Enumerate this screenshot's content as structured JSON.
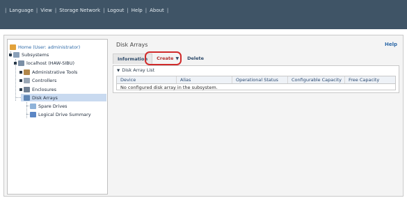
{
  "topnav": [
    "Language",
    "View",
    "Storage Network",
    "Logout",
    "Help",
    "About"
  ],
  "tree": {
    "home": "Home (User: administrator)",
    "subsystems": "Subsystems",
    "localhost": "localhost (HAW-SIBU)",
    "admin_tools": "Administrative Tools",
    "controllers": "Controllers",
    "enclosures": "Enclosures",
    "disk_arrays": "Disk Arrays",
    "spare_drives": "Spare Drives",
    "logical_drive_summary": "Logical Drive Summary"
  },
  "main": {
    "title": "Disk Arrays",
    "help": "Help",
    "tabs": {
      "information": "Information",
      "create": "Create",
      "delete": "Delete"
    },
    "panel_title": "Disk Array List",
    "columns": [
      "Device",
      "Alias",
      "Operational Status",
      "Configurable Capacity",
      "Free Capacity"
    ],
    "empty_message": "No configured disk array in the subsystem."
  }
}
